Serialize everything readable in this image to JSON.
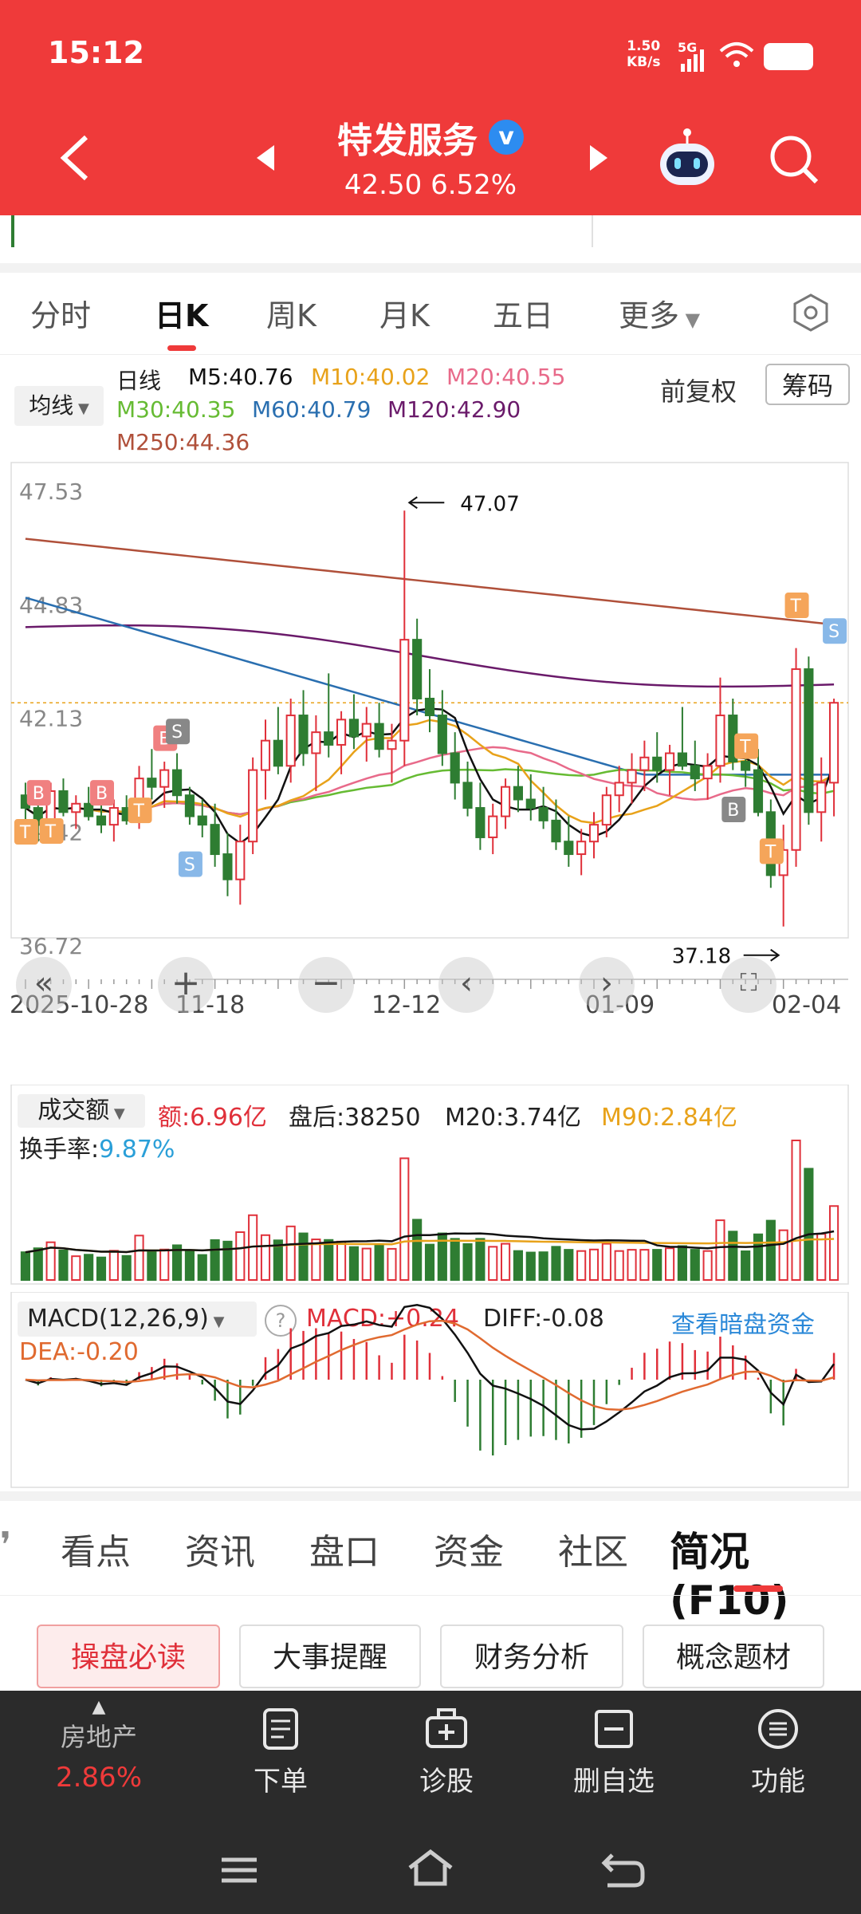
{
  "status": {
    "time": "15:12",
    "net_speed": "1.50",
    "net_unit": "KB/s",
    "signal": "5G"
  },
  "header": {
    "title": "特发服务",
    "verified_mark": "v",
    "price": "42.50",
    "change": "6.52%",
    "price_line": "42.50 6.52%"
  },
  "ktabs": [
    "分时",
    "日K",
    "周K",
    "月K",
    "五日",
    "更多"
  ],
  "ma_legend": {
    "selector": "均线",
    "line_label": "日线",
    "m5": "M5:40.76",
    "m10": "M10:40.02",
    "m20": "M20:40.55",
    "m30": "M30:40.35",
    "m60": "M60:40.79",
    "m120": "M120:42.90",
    "m250": "M250:44.36",
    "adjust": "前复权",
    "chips": "筹码"
  },
  "chart_axis": {
    "y_ticks": [
      "47.53",
      "44.83",
      "42.13",
      "39.42",
      "36.72"
    ],
    "x_ticks": [
      "2025-10-28",
      "11-18",
      "12-12",
      "01-09",
      "02-04"
    ],
    "high_label": "47.07",
    "low_label": "37.18"
  },
  "volume_legend": {
    "selector": "成交额",
    "amount": "额:6.96亿",
    "after_hours": "盘后:38250",
    "m20": "M20:3.74亿",
    "m90": "M90:2.84亿",
    "turnover_label": "换手率:",
    "turnover_value": "9.87%"
  },
  "macd_legend": {
    "selector": "MACD(12,26,9)",
    "help": "?",
    "macd": "MACD:+0.24",
    "diff": "DIFF:-0.08",
    "dea": "DEA:-0.20",
    "link": "查看暗盘资金"
  },
  "bottom_tabs": [
    "看点",
    "资讯",
    "盘口",
    "资金",
    "社区",
    "简况(F10)"
  ],
  "f10_buttons": [
    "操盘必读",
    "大事提醒",
    "财务分析",
    "概念题材"
  ],
  "bottom_nav": {
    "sector_name": "房地产",
    "sector_change": "2.86%",
    "items": [
      "下单",
      "诊股",
      "删自选",
      "功能"
    ]
  },
  "colors": {
    "header_red": "#ef3a3a",
    "up": "#e0303a",
    "down": "#2e7d32",
    "m5": "#111111",
    "m10": "#e8a21a",
    "m20": "#e86a8a",
    "m30": "#66bb33",
    "m60": "#2a6fb0",
    "m120": "#6a1a6a",
    "m250": "#b0503a"
  },
  "chart_data": {
    "type": "candlestick",
    "y_range": [
      36.72,
      47.53
    ],
    "x_start": "2025-10-28",
    "x_end": "2026-02-04",
    "ohlc": [
      [
        40.3,
        40.6,
        39.6,
        40.0
      ],
      [
        40.0,
        40.4,
        39.2,
        39.6
      ],
      [
        39.6,
        40.6,
        39.4,
        40.4
      ],
      [
        40.4,
        40.7,
        39.8,
        39.9
      ],
      [
        39.9,
        40.3,
        39.5,
        40.1
      ],
      [
        40.1,
        40.5,
        39.7,
        39.8
      ],
      [
        39.8,
        40.1,
        39.4,
        39.6
      ],
      [
        39.6,
        40.2,
        39.2,
        40.0
      ],
      [
        40.0,
        40.3,
        39.6,
        39.7
      ],
      [
        39.7,
        41.0,
        39.5,
        40.7
      ],
      [
        40.7,
        41.4,
        40.2,
        40.5
      ],
      [
        40.5,
        41.1,
        40.0,
        40.9
      ],
      [
        40.9,
        41.3,
        40.1,
        40.3
      ],
      [
        40.3,
        40.5,
        39.6,
        39.8
      ],
      [
        39.8,
        40.2,
        39.3,
        39.6
      ],
      [
        39.6,
        40.1,
        38.6,
        38.9
      ],
      [
        38.9,
        39.4,
        37.9,
        38.3
      ],
      [
        38.3,
        39.6,
        37.7,
        39.2
      ],
      [
        39.2,
        41.2,
        38.9,
        40.9
      ],
      [
        40.9,
        42.1,
        40.2,
        41.6
      ],
      [
        41.6,
        42.4,
        40.8,
        41.0
      ],
      [
        41.0,
        42.6,
        40.6,
        42.2
      ],
      [
        42.2,
        42.8,
        41.0,
        41.3
      ],
      [
        41.3,
        42.2,
        40.4,
        41.8
      ],
      [
        41.8,
        43.2,
        41.2,
        41.5
      ],
      [
        41.5,
        42.3,
        40.8,
        42.1
      ],
      [
        42.1,
        42.7,
        41.4,
        41.7
      ],
      [
        41.7,
        42.4,
        41.1,
        42.0
      ],
      [
        42.0,
        42.5,
        41.2,
        41.4
      ],
      [
        41.4,
        42.0,
        40.6,
        41.6
      ],
      [
        41.6,
        47.07,
        41.0,
        44.0
      ],
      [
        44.0,
        44.5,
        42.2,
        42.6
      ],
      [
        42.6,
        43.3,
        41.8,
        42.2
      ],
      [
        42.2,
        42.8,
        41.0,
        41.3
      ],
      [
        41.3,
        41.8,
        40.2,
        40.6
      ],
      [
        40.6,
        41.1,
        39.8,
        40.0
      ],
      [
        40.0,
        40.6,
        39.0,
        39.3
      ],
      [
        39.3,
        40.1,
        38.9,
        39.8
      ],
      [
        39.8,
        40.7,
        39.5,
        40.5
      ],
      [
        40.5,
        41.0,
        39.9,
        40.2
      ],
      [
        40.2,
        40.8,
        39.7,
        40.0
      ],
      [
        40.0,
        40.5,
        39.5,
        39.7
      ],
      [
        39.7,
        40.2,
        39.0,
        39.2
      ],
      [
        39.2,
        39.8,
        38.6,
        38.9
      ],
      [
        38.9,
        39.5,
        38.4,
        39.2
      ],
      [
        39.2,
        39.9,
        38.8,
        39.6
      ],
      [
        39.6,
        40.5,
        39.3,
        40.3
      ],
      [
        40.3,
        41.0,
        39.9,
        40.6
      ],
      [
        40.6,
        41.3,
        40.1,
        40.9
      ],
      [
        40.9,
        41.6,
        40.4,
        41.2
      ],
      [
        41.2,
        41.8,
        40.6,
        40.9
      ],
      [
        40.9,
        41.5,
        40.3,
        41.3
      ],
      [
        41.3,
        42.4,
        40.9,
        41.0
      ],
      [
        41.0,
        41.6,
        40.4,
        40.7
      ],
      [
        40.7,
        41.3,
        40.2,
        41.0
      ],
      [
        41.0,
        43.1,
        40.6,
        42.2
      ],
      [
        42.2,
        42.6,
        40.9,
        41.1
      ],
      [
        41.1,
        41.7,
        40.5,
        40.9
      ],
      [
        40.9,
        41.4,
        39.8,
        39.9
      ],
      [
        39.9,
        40.2,
        38.1,
        38.4
      ],
      [
        38.4,
        39.6,
        37.18,
        39.0
      ],
      [
        39.0,
        43.8,
        38.6,
        43.3
      ],
      [
        43.3,
        43.6,
        39.6,
        39.9
      ],
      [
        39.9,
        41.2,
        39.2,
        40.6
      ],
      [
        40.6,
        42.6,
        39.8,
        42.5
      ]
    ],
    "volume_unit": "亿",
    "annotations": {
      "high": "47.07",
      "low": "37.18"
    }
  }
}
